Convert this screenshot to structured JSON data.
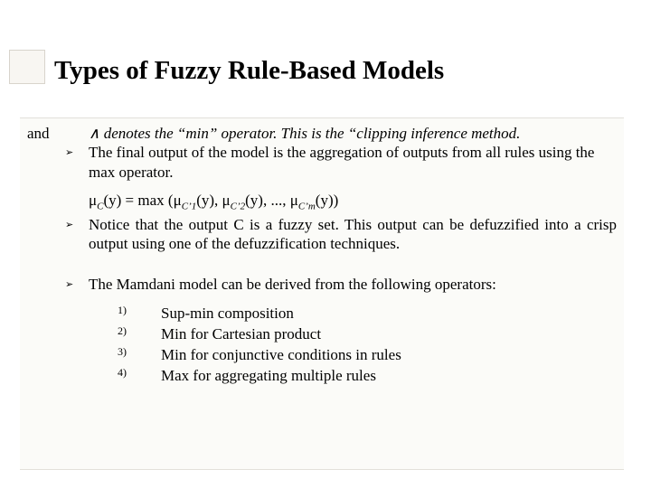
{
  "title": "Types of Fuzzy Rule-Based Models",
  "lead_and": "and",
  "wedge": "∧",
  "min_operator_sentence": " denotes the “min” operator. This is the “clipping inference method.",
  "aggregation_sentence": "The final output of the model is the aggregation of outputs from all rules using the max operator.",
  "formula": {
    "mu": "μ",
    "C": "C",
    "Cprime": "C’",
    "one": "1",
    "two": "2",
    "m": "m",
    "prefix": "(y) = max (",
    "yarg": "(y), ",
    "ellipsis": "..., ",
    "yclose": "(y))"
  },
  "notice_sentence": "Notice that the output C is a fuzzy set. This output can be defuzzified into a crisp output using one of the defuzzification techniques.",
  "mamdani_sentence": "The Mamdani model can be derived from the following operators:",
  "numbered": {
    "n1": "1)",
    "n2": "2)",
    "n3": "3)",
    "n4": "4)",
    "i1": "Sup-min composition",
    "i2": "Min for Cartesian product",
    "i3": "Min for conjunctive conditions in rules",
    "i4": "Max for aggregating multiple rules"
  },
  "bullet_glyph": "➢"
}
